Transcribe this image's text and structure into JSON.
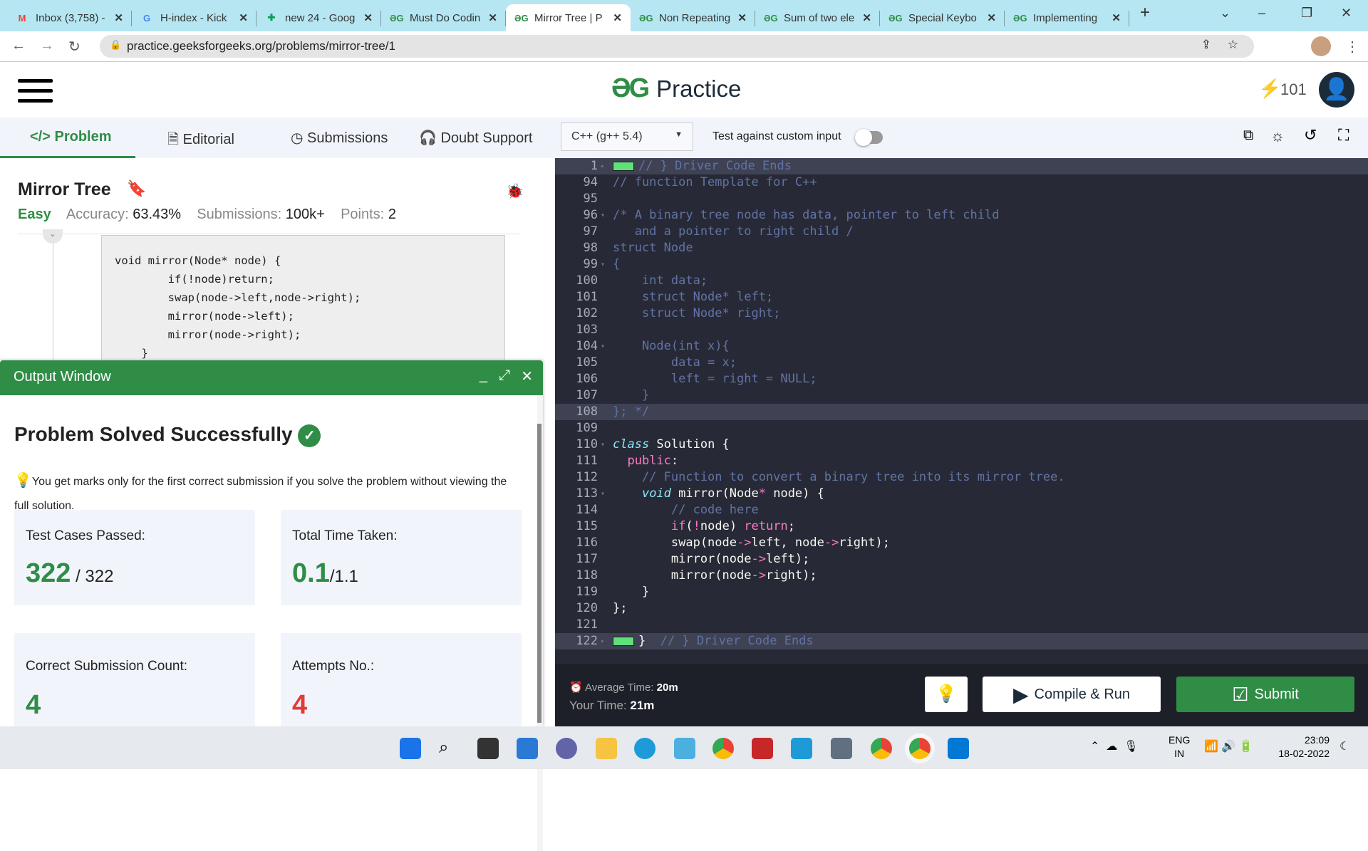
{
  "browser": {
    "tabs": [
      {
        "icon": "gmail-icon",
        "label": "Inbox (3,758) -"
      },
      {
        "icon": "google-icon",
        "label": "H-index - Kick"
      },
      {
        "icon": "sheets-icon",
        "label": "new 24 - Goog"
      },
      {
        "icon": "gfg-icon",
        "label": "Must Do Codin"
      },
      {
        "icon": "gfg-icon",
        "label": "Mirror Tree | P",
        "active": true
      },
      {
        "icon": "gfg-icon",
        "label": "Non Repeating"
      },
      {
        "icon": "gfg-icon",
        "label": "Sum of two ele"
      },
      {
        "icon": "gfg-icon",
        "label": "Special Keybo"
      },
      {
        "icon": "gfg-icon",
        "label": "Implementing"
      }
    ],
    "url": "practice.geeksforgeeks.org/problems/mirror-tree/1"
  },
  "header": {
    "logo": "Practice",
    "streak": "101"
  },
  "problem_tabs": [
    "Problem",
    "Editorial",
    "Submissions",
    "Doubt Support"
  ],
  "editor_toolbar": {
    "language": "C++ (g++ 5.4)",
    "custom_input_label": "Test against custom input",
    "custom_input_on": false
  },
  "problem": {
    "title": "Mirror Tree",
    "difficulty": "Easy",
    "accuracy_label": "Accuracy:",
    "accuracy": "63.43%",
    "submissions_label": "Submissions:",
    "submissions": "100k+",
    "points_label": "Points:",
    "points": "2",
    "snippet": [
      "void mirror(Node* node) {",
      "        if(!node)return;",
      "        swap(node->left,node->right);",
      "        mirror(node->left);",
      "        mirror(node->right);",
      "    }"
    ]
  },
  "output": {
    "title": "Output Window",
    "status": "Problem Solved Successfully",
    "tip": "You get marks only for the first correct submission if you solve the problem without viewing the full solution.",
    "cards": [
      {
        "label": "Test Cases Passed:",
        "value": "322",
        "suffix": " / 322"
      },
      {
        "label": "Total Time Taken:",
        "value": "0.1",
        "suffix": "/1.1"
      },
      {
        "label": "Correct Submission Count:",
        "value": "4",
        "suffix": ""
      },
      {
        "label": "Attempts No.:",
        "value": "4",
        "suffix": "",
        "color": "#e53935"
      }
    ]
  },
  "code": [
    {
      "n": "1",
      "fold": "right",
      "hl": true,
      "box": true,
      "t": [
        [
          "// } Driver Code Ends",
          "c"
        ]
      ]
    },
    {
      "n": "94",
      "t": [
        [
          "// function Template for C++",
          "c"
        ]
      ]
    },
    {
      "n": "95",
      "t": []
    },
    {
      "n": "96",
      "fold": "down",
      "t": [
        [
          "/* A binary tree node has data, pointer to left child",
          "c"
        ]
      ]
    },
    {
      "n": "97",
      "t": [
        [
          "   and a pointer to right child /",
          "c"
        ]
      ]
    },
    {
      "n": "98",
      "t": [
        [
          "struct Node",
          "c"
        ]
      ]
    },
    {
      "n": "99",
      "fold": "down",
      "t": [
        [
          "{",
          "c"
        ]
      ]
    },
    {
      "n": "100",
      "t": [
        [
          "    int data;",
          "c"
        ]
      ]
    },
    {
      "n": "101",
      "t": [
        [
          "    struct Node* left;",
          "c"
        ]
      ]
    },
    {
      "n": "102",
      "t": [
        [
          "    struct Node* right;",
          "c"
        ]
      ]
    },
    {
      "n": "103",
      "t": []
    },
    {
      "n": "104",
      "fold": "down",
      "t": [
        [
          "    Node(int x){",
          "c"
        ]
      ]
    },
    {
      "n": "105",
      "t": [
        [
          "        data = x;",
          "c"
        ]
      ]
    },
    {
      "n": "106",
      "t": [
        [
          "        left = right = NULL;",
          "c"
        ]
      ]
    },
    {
      "n": "107",
      "t": [
        [
          "    }",
          "c"
        ]
      ]
    },
    {
      "n": "108",
      "hl": true,
      "t": [
        [
          "}; */",
          "c"
        ]
      ]
    },
    {
      "n": "109",
      "t": []
    },
    {
      "n": "110",
      "fold": "down",
      "t": [
        [
          "class",
          "t"
        ],
        [
          " Solution {",
          "w"
        ]
      ]
    },
    {
      "n": "111",
      "t": [
        [
          "  ",
          "w"
        ],
        [
          "public",
          "k"
        ],
        [
          ":",
          "w"
        ]
      ]
    },
    {
      "n": "112",
      "t": [
        [
          "    // Function to convert a binary tree into its mirror tree.",
          "c"
        ]
      ]
    },
    {
      "n": "113",
      "fold": "down",
      "t": [
        [
          "    ",
          "w"
        ],
        [
          "void",
          "t"
        ],
        [
          " mirror(Node",
          "w"
        ],
        [
          "*",
          "k"
        ],
        [
          " node) {",
          "w"
        ]
      ]
    },
    {
      "n": "114",
      "t": [
        [
          "        // code here",
          "c"
        ]
      ]
    },
    {
      "n": "115",
      "t": [
        [
          "        ",
          "w"
        ],
        [
          "if",
          "k"
        ],
        [
          "(",
          "w"
        ],
        [
          "!",
          "k"
        ],
        [
          "node) ",
          "w"
        ],
        [
          "return",
          "k"
        ],
        [
          ";",
          "w"
        ]
      ]
    },
    {
      "n": "116",
      "t": [
        [
          "        swap(node",
          "w"
        ],
        [
          "->",
          "k"
        ],
        [
          "left, node",
          "w"
        ],
        [
          "->",
          "k"
        ],
        [
          "right);",
          "w"
        ]
      ]
    },
    {
      "n": "117",
      "t": [
        [
          "        mirror(node",
          "w"
        ],
        [
          "->",
          "k"
        ],
        [
          "left);",
          "w"
        ]
      ]
    },
    {
      "n": "118",
      "t": [
        [
          "        mirror(node",
          "w"
        ],
        [
          "->",
          "k"
        ],
        [
          "right);",
          "w"
        ]
      ]
    },
    {
      "n": "119",
      "t": [
        [
          "    }",
          "w"
        ]
      ]
    },
    {
      "n": "120",
      "t": [
        [
          "};",
          "w"
        ]
      ]
    },
    {
      "n": "121",
      "t": []
    },
    {
      "n": "122",
      "fold": "right",
      "hl": true,
      "box": true,
      "t": [
        [
          "}",
          "w"
        ],
        [
          "  // } Driver Code Ends",
          "c"
        ]
      ]
    }
  ],
  "footer": {
    "avg_label": "Average Time:",
    "avg": "20m",
    "your_label": "Your Time:",
    "your": "21m",
    "compile": "Compile & Run",
    "submit": "Submit"
  },
  "taskbar": {
    "lang": "ENG",
    "region": "IN",
    "time": "23:09",
    "date": "18-02-2022"
  },
  "colors": {
    "brand": "#2f8d46",
    "editor_bg": "#272a36",
    "attempts": "#e53935"
  }
}
